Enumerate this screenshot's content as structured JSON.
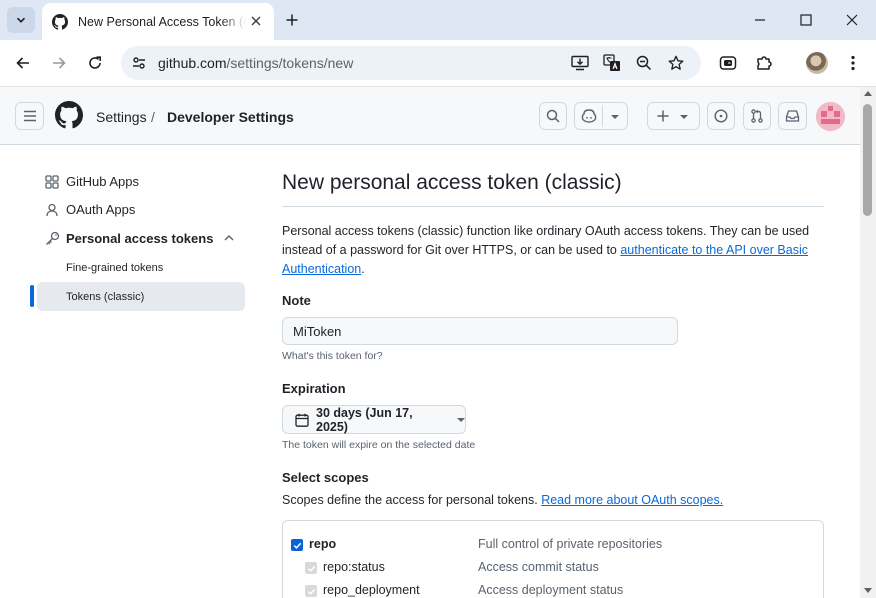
{
  "browser": {
    "tab_title": "New Personal Access Token (Classic)",
    "url_host": "github.com",
    "url_path": "/settings/tokens/new"
  },
  "header": {
    "breadcrumb_settings": "Settings",
    "breadcrumb_separator": "/",
    "breadcrumb_developer": "Developer Settings"
  },
  "sidebar": {
    "items": [
      {
        "label": "GitHub Apps",
        "icon": "apps-icon"
      },
      {
        "label": "OAuth Apps",
        "icon": "person-icon"
      },
      {
        "label": "Personal access tokens",
        "icon": "key-icon"
      }
    ],
    "subitems": [
      {
        "label": "Fine-grained tokens"
      },
      {
        "label": "Tokens (classic)"
      }
    ]
  },
  "main": {
    "title": "New personal access token (classic)",
    "intro_text": "Personal access tokens (classic) function like ordinary OAuth access tokens. They can be used instead of a password for Git over HTTPS, or can be used to ",
    "intro_link": "authenticate to the API over Basic Authentication",
    "intro_end": ".",
    "note_label": "Note",
    "note_value": "MiToken",
    "note_hint": "What's this token for?",
    "expiration_label": "Expiration",
    "expiration_value": "30 days (Jun 17, 2025)",
    "expiration_hint": "The token will expire on the selected date",
    "scopes_label": "Select scopes",
    "scopes_desc": "Scopes define the access for personal tokens. ",
    "scopes_link": "Read more about OAuth scopes.",
    "scopes": [
      {
        "name": "repo",
        "desc": "Full control of private repositories",
        "checked": true,
        "child": false
      },
      {
        "name": "repo:status",
        "desc": "Access commit status",
        "checked": true,
        "child": true
      },
      {
        "name": "repo_deployment",
        "desc": "Access deployment status",
        "checked": true,
        "child": true
      }
    ]
  },
  "colors": {
    "accent": "#0969da",
    "checkbox": "#0b63d6"
  }
}
